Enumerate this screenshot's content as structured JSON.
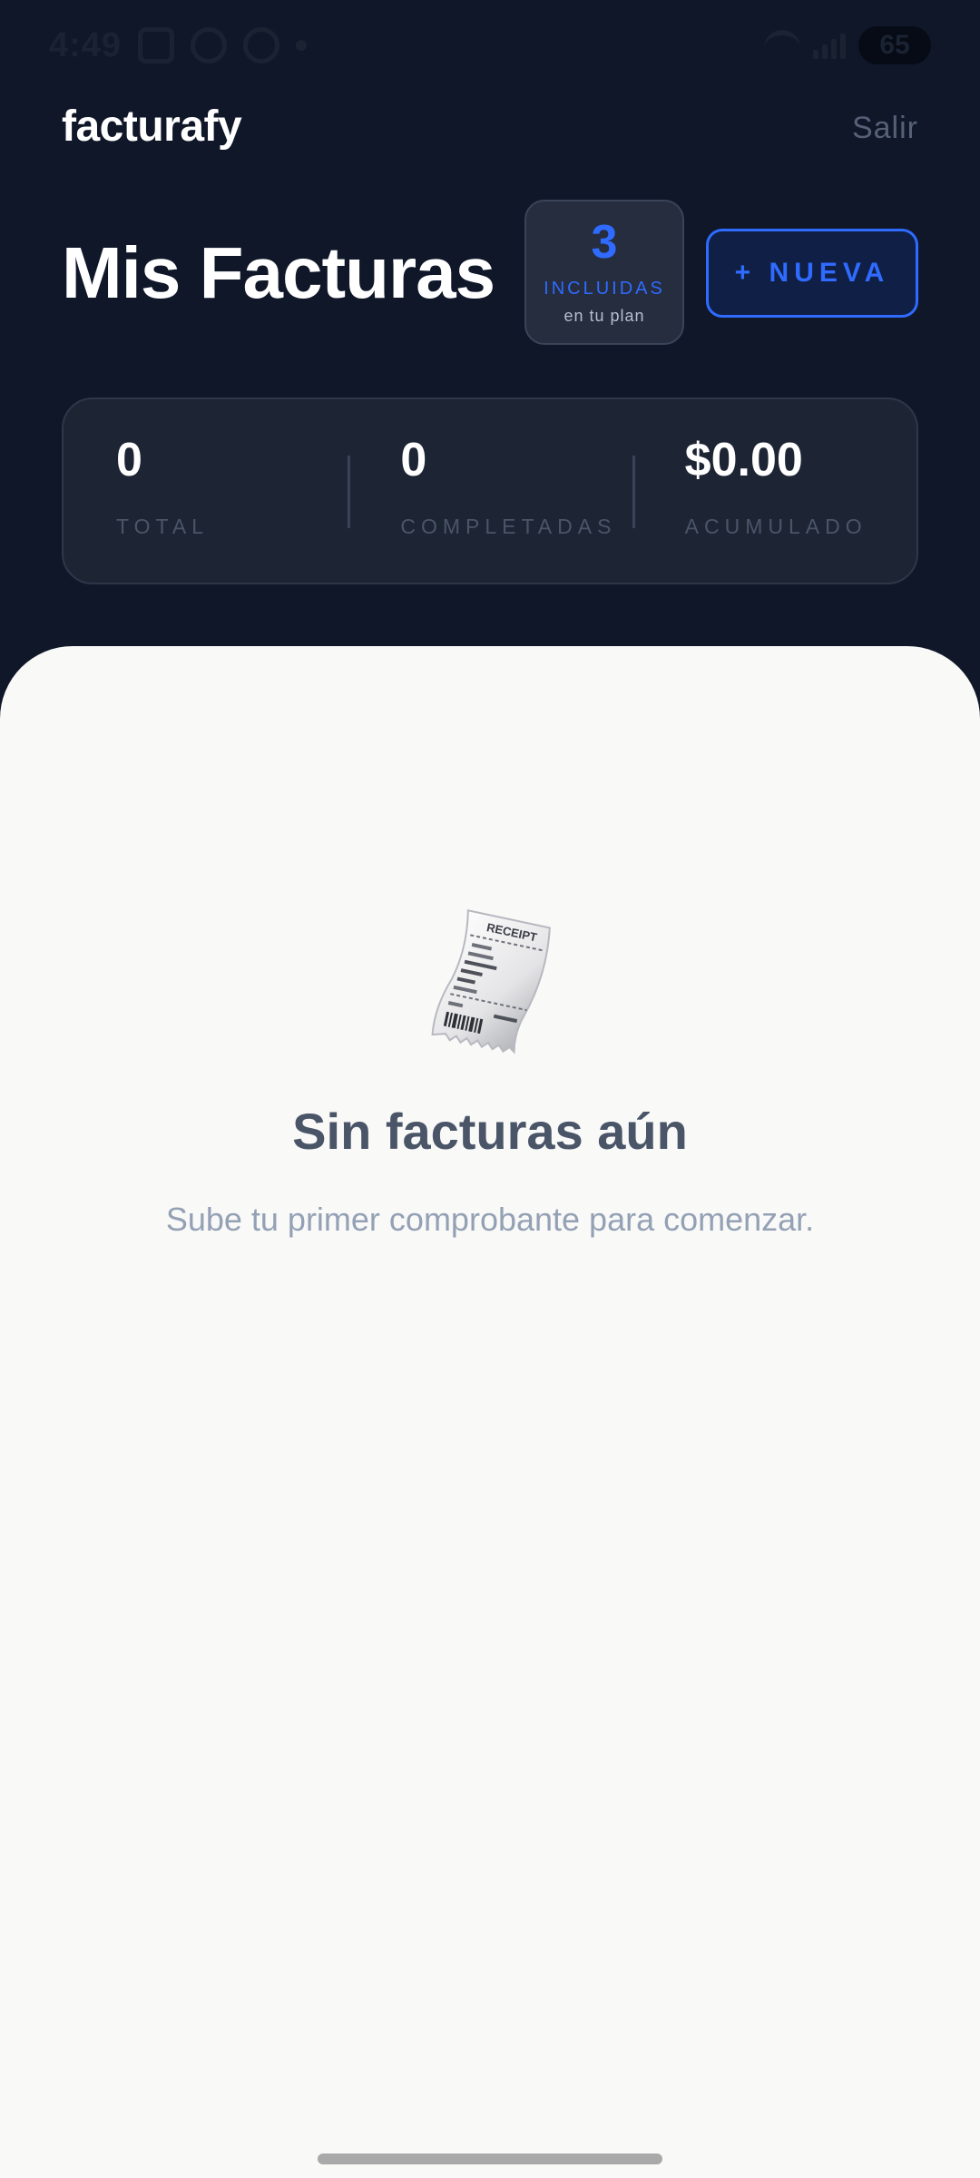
{
  "status_bar": {
    "time": "4:49",
    "battery": "65"
  },
  "header": {
    "brand": "facturafy",
    "logout_label": "Salir"
  },
  "page": {
    "title": "Mis Facturas"
  },
  "plan_badge": {
    "count": "3",
    "label": "INCLUIDAS",
    "sub": "en tu plan"
  },
  "new_button": {
    "label": "+ NUEVA"
  },
  "stats": [
    {
      "value": "0",
      "label": "TOTAL"
    },
    {
      "value": "0",
      "label": "COMPLETADAS"
    },
    {
      "value": "$0.00",
      "label": "ACUMULADO"
    }
  ],
  "empty_state": {
    "icon": "receipt-icon",
    "receipt_header": "RECEIPT",
    "title": "Sin facturas aún",
    "subtitle": "Sube tu primer comprobante para comenzar."
  },
  "colors": {
    "background": "#0f1729",
    "accent": "#2f6bff",
    "card": "#1d2535",
    "sheet": "#f9f9f8"
  }
}
